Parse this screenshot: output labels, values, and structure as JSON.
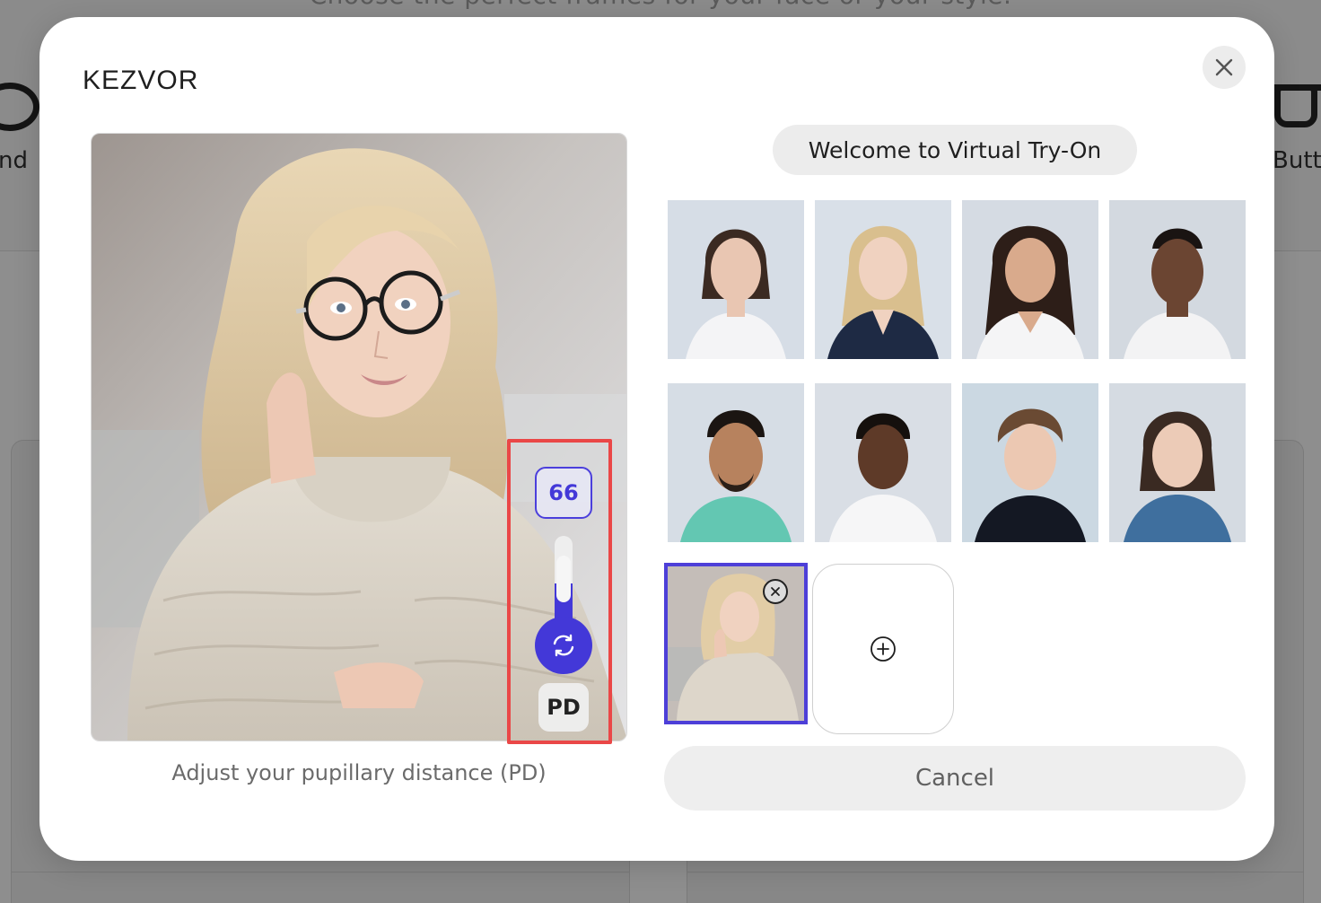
{
  "background": {
    "heading": "Choose the perfect frames for your face or your style.",
    "left_label": "nd",
    "right_label": "Butt"
  },
  "modal": {
    "brand": "KEZVOR",
    "close_icon": "close-icon",
    "caption": "Adjust your pupillary distance (PD)",
    "welcome_title": "Welcome to Virtual Try-On",
    "cancel_label": "Cancel"
  },
  "pd_control": {
    "value": "66",
    "label": "PD",
    "slider_level": 0.55,
    "knob_icon": "refresh-icon"
  },
  "models": [
    {
      "name": "model-1",
      "icon": "portrait"
    },
    {
      "name": "model-2",
      "icon": "portrait"
    },
    {
      "name": "model-3",
      "icon": "portrait"
    },
    {
      "name": "model-4",
      "icon": "portrait"
    },
    {
      "name": "model-5",
      "icon": "portrait"
    },
    {
      "name": "model-6",
      "icon": "portrait"
    },
    {
      "name": "model-7",
      "icon": "portrait"
    },
    {
      "name": "model-8",
      "icon": "portrait"
    }
  ],
  "colors": {
    "accent": "#4338d8",
    "highlight": "#ea4747",
    "chip_bg": "#ececec"
  }
}
